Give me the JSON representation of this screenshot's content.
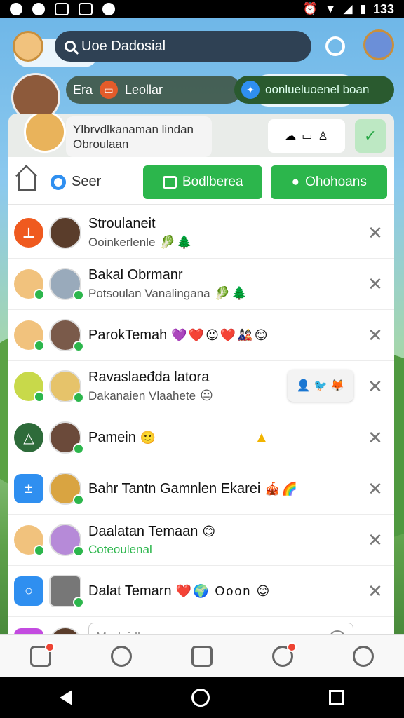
{
  "status_bar": {
    "time": "133"
  },
  "top": {
    "search_text": "Uoe Dadosial"
  },
  "row2": {
    "pill_a": "Leollar",
    "pill_a_prefix": "Era",
    "pill_b": "oonlueluoenel boan"
  },
  "notification": {
    "text": "Ylbrvdlkanaman lindan Obroulaan"
  },
  "tabs": {
    "seer": "Seer",
    "button1": "Bodlberea",
    "button2": "Ohohoans"
  },
  "list": [
    {
      "name": "Stroulaneit",
      "sub": "Ooinkerlenle",
      "emoji": "🥬🌲",
      "lead_color": "#ef5a1f",
      "lead_icon": "⊥"
    },
    {
      "name": "Bakal Obrmanr",
      "sub": "Potsoulan Vanalingana",
      "emoji": "🥬🌲"
    },
    {
      "name": "ParokTemah",
      "sub": "",
      "emoji": "💜❤️😉❤️🎎😊"
    },
    {
      "name": "Ravaslaeđda latora",
      "sub": "Dakanaien Vlaahete",
      "emoji": "😐",
      "bubble": "👤 🐦 🦊"
    },
    {
      "name": "Pamein",
      "sub": "",
      "emoji": "🙂",
      "lead_color": "#2e6b3a",
      "lead_icon": "△"
    },
    {
      "name": "Bahr Tantn Gamnlen Ekarei",
      "sub": "",
      "emoji": "🎪🌈",
      "lead_color": "#2f8ff0",
      "lead_icon": "±"
    },
    {
      "name": "Daalatan Temaan",
      "sub": "Coteoulenal",
      "sub_green": true,
      "emoji": "😊"
    },
    {
      "name": "Dalat Temarn",
      "sub": "",
      "emoji": "❤️🌍 Ooon 😊",
      "lead_color": "#2f8ff0",
      "lead_icon": "○"
    }
  ],
  "compose": {
    "placeholder": "Madnidlsmars"
  }
}
